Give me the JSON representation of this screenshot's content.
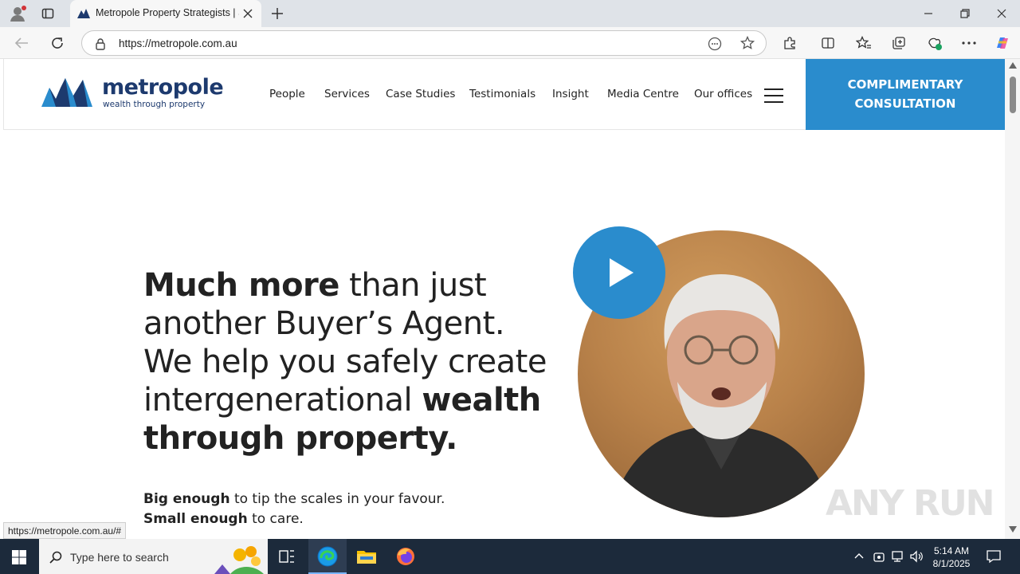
{
  "browser": {
    "tab_title": "Metropole Property Strategists | S",
    "url": "https://metropole.com.au",
    "status_url": "https://metropole.com.au/#"
  },
  "site": {
    "brand_name": "metropole",
    "brand_tagline": "wealth through property",
    "nav": [
      "People",
      "Services",
      "Case Studies",
      "Testimonials",
      "Insight",
      "Media Centre",
      "Our offices"
    ],
    "cta_line1": "COMPLIMENTARY",
    "cta_line2": "CONSULTATION",
    "headline": {
      "bold1": "Much more",
      "normal1": " than just another Buyer’s Agent. We help you safely create intergenerational ",
      "bold2": "wealth through property."
    },
    "sub1_bold": "Big enough",
    "sub1_normal": " to tip the scales in your favour.",
    "sub2_bold": "Small enough",
    "sub2_normal": " to care."
  },
  "colors": {
    "brand_blue": "#2a8ccd",
    "brand_navy": "#1d3a6e"
  },
  "taskbar": {
    "search_placeholder": "Type here to search",
    "time": "5:14 AM",
    "date": "8/1/2025"
  },
  "watermark": "ANY RUN"
}
